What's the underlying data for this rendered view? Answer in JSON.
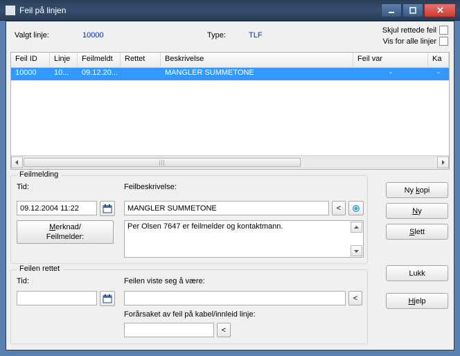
{
  "window": {
    "title": "Feil på linjen"
  },
  "info": {
    "valgt_label": "Valgt linje:",
    "valgt_value": "10000",
    "type_label": "Type:",
    "type_value": "TLF",
    "opt_skjul": "Skjul rettede feil",
    "opt_alle": "Vis for alle linjer"
  },
  "grid": {
    "headers": [
      "Feil ID",
      "Linje",
      "Feilmeldt",
      "Rettet",
      "Beskrivelse",
      "Feil var",
      "Ka"
    ],
    "rows": [
      {
        "id": "10000",
        "linje": "10...",
        "feilmeldt": "09.12.20...",
        "rettet": "",
        "beskrivelse": "MANGLER SUMMETONE",
        "feilvar": "-",
        "ka": "-"
      }
    ]
  },
  "feilmelding": {
    "group_title": "Feilmelding",
    "tid_label": "Tid:",
    "tid_value": "09.12.2004 11:22",
    "beskr_label": "Feilbeskrivelse:",
    "beskr_value": "MANGLER SUMMETONE",
    "merknad_btn_l1": "Merknad/",
    "merknad_btn_l2": "Feilmelder:",
    "merknad_text": "Per Olsen 7647 er feilmelder og kontaktmann."
  },
  "rettet": {
    "group_title": "Feilen rettet",
    "tid_label": "Tid:",
    "tid_value": "",
    "viste_label": "Feilen viste seg å være:",
    "viste_value": "",
    "forar_label": "Forårsaket av feil på kabel/innleid linje:",
    "forar_value": ""
  },
  "buttons": {
    "nykopi": "Ny kopi",
    "ny": "Ny",
    "slett": "Slett",
    "lukk": "Lukk",
    "hjelp": "Hjelp"
  },
  "icons": {
    "left": "‹",
    "right": "›",
    "up": "▴",
    "down": "▾",
    "lt": "<"
  }
}
